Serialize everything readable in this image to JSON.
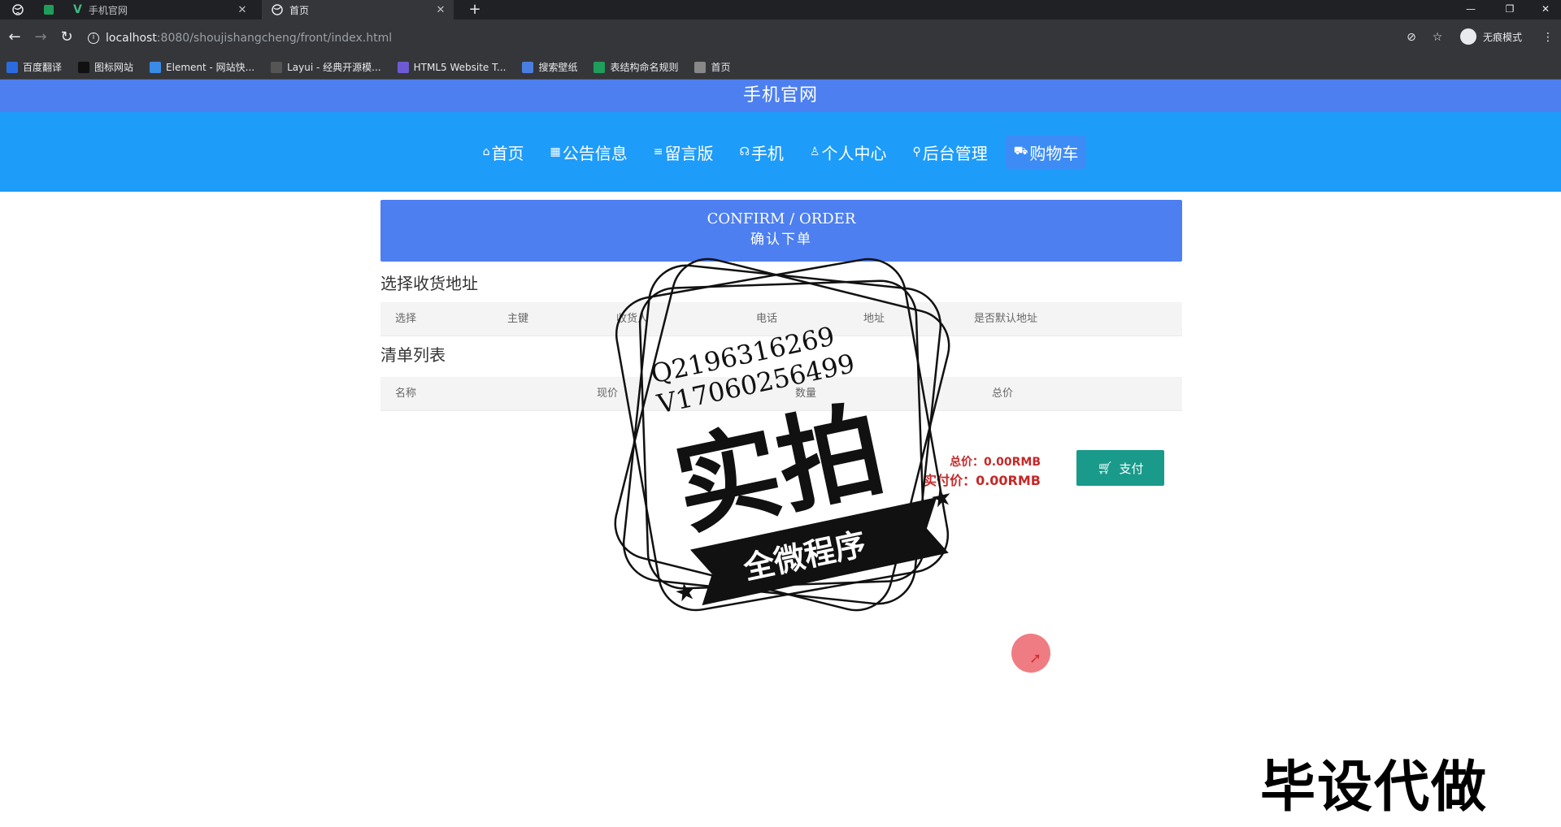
{
  "browser": {
    "tabs": [
      {
        "title": "手机官网",
        "active": false
      },
      {
        "title": "首页",
        "active": true
      }
    ],
    "url_host": "localhost",
    "url_path": ":8080/shoujishangcheng/front/index.html",
    "profile_label": "无痕模式",
    "bookmarks": [
      {
        "label": "百度翻译",
        "color": "#2a6ce0",
        "icon": "translate-icon"
      },
      {
        "label": "图标网站",
        "color": "#111111",
        "icon": "flag-icon"
      },
      {
        "label": "Element - 网站快...",
        "color": "#3a8be8",
        "icon": "element-icon"
      },
      {
        "label": "Layui - 经典开源模...",
        "color": "#555555",
        "icon": "layui-icon"
      },
      {
        "label": "HTML5 Website T...",
        "color": "#6e5bd4",
        "icon": "html5-icon"
      },
      {
        "label": "搜索壁纸",
        "color": "#4a7de0",
        "icon": "wallpaper-icon"
      },
      {
        "label": "表结构命名规则",
        "color": "#1e9e5a",
        "icon": "sheet-icon"
      },
      {
        "label": "首页",
        "color": "#888888",
        "icon": "globe-icon"
      }
    ]
  },
  "site": {
    "title": "手机官网"
  },
  "nav": [
    {
      "icon": "⌂",
      "icon_name": "home-icon",
      "label": "首页",
      "active": false
    },
    {
      "icon": "▦",
      "icon_name": "notice-icon",
      "label": "公告信息",
      "active": false
    },
    {
      "icon": "≡",
      "icon_name": "message-icon",
      "label": "留言版",
      "active": false
    },
    {
      "icon": "☊",
      "icon_name": "phone-icon",
      "label": "手机",
      "active": false
    },
    {
      "icon": "♙",
      "icon_name": "user-icon",
      "label": "个人中心",
      "active": false
    },
    {
      "icon": "⚲",
      "icon_name": "link-icon",
      "label": "后台管理",
      "active": false
    },
    {
      "icon": "⛟",
      "icon_name": "cart-icon",
      "label": "购物车",
      "active": true
    }
  ],
  "banner": {
    "en": "CONFIRM / ORDER",
    "cn": "确认下单"
  },
  "address": {
    "title": "选择收货地址",
    "columns": [
      "选择",
      "主键",
      "收货人",
      "电话",
      "地址",
      "是否默认地址"
    ]
  },
  "items": {
    "title": "清单列表",
    "columns": [
      "名称",
      "现价",
      "数量",
      "总价"
    ]
  },
  "summary": {
    "total_label": "总价：0.00RMB",
    "paid_label": "实付价：0.00RMB",
    "pay_button": "支付"
  },
  "overlay": {
    "stamp_line1": "Q2196316269",
    "stamp_line2": "V17060256499",
    "stamp_main": "实拍",
    "stamp_ribbon": "全微程序",
    "watermark": "毕设代做"
  },
  "colors": {
    "header_blue": "#4d7ff0",
    "nav_blue": "#1e9cf9",
    "pay_green": "#199a8b",
    "price_red": "#c62828"
  }
}
